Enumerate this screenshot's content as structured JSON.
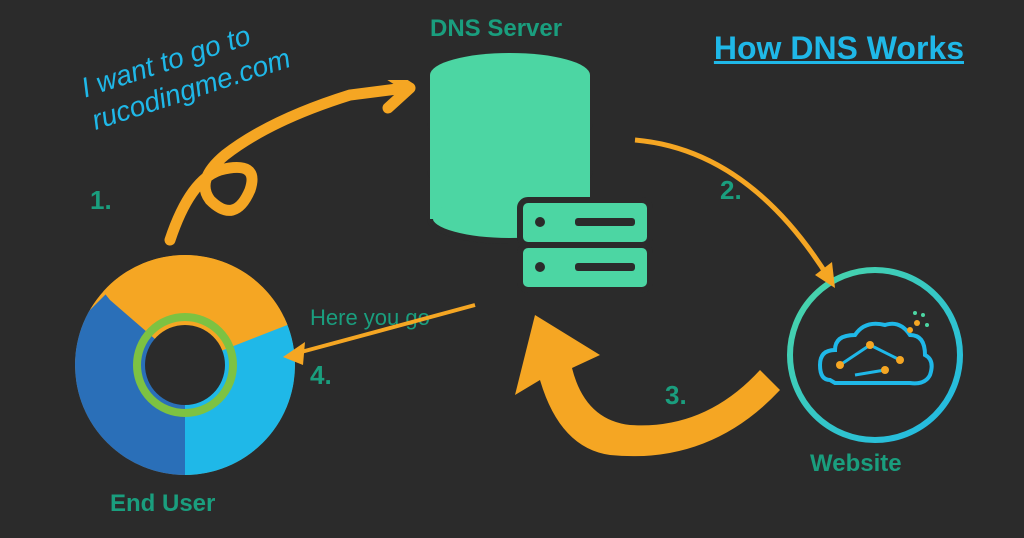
{
  "title": "How DNS Works",
  "labels": {
    "dns_server": "DNS Server",
    "end_user": "End User",
    "website": "Website"
  },
  "steps": {
    "one": "1.",
    "two": "2.",
    "three": "3.",
    "four": "4."
  },
  "messages": {
    "request": "I want to go to rucodingme.com",
    "response": "Here you go"
  },
  "colors": {
    "bg": "#2b2b2b",
    "teal": "#1a9e7e",
    "blue": "#1fb8e8",
    "orange": "#f5a623",
    "green": "#4cd6a3",
    "dark_blue": "#2a6fb8"
  }
}
